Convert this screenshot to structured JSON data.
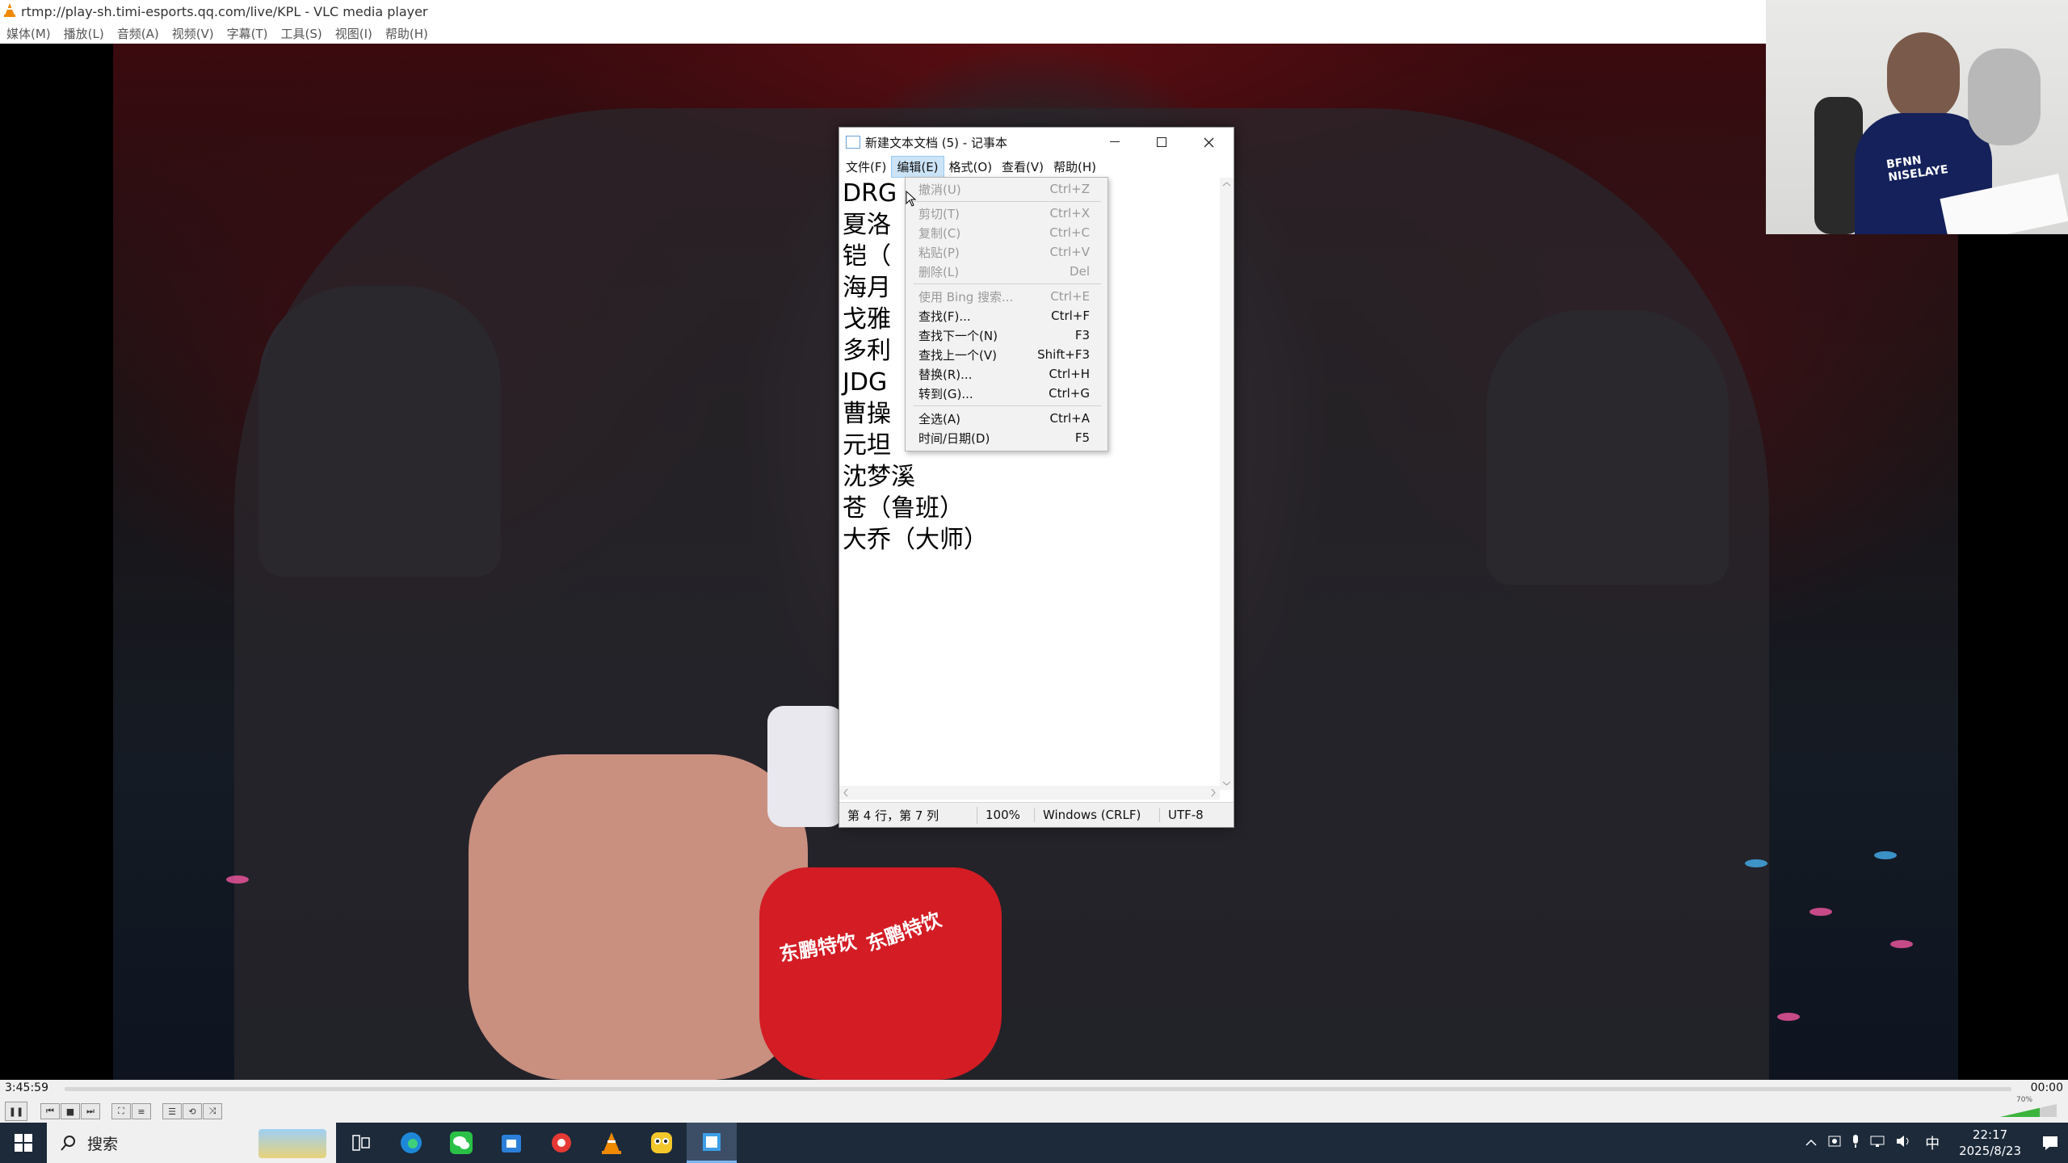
{
  "vlc": {
    "title": "rtmp://play-sh.timi-esports.qq.com/live/KPL - VLC media player",
    "menu": [
      "媒体(M)",
      "播放(L)",
      "音频(A)",
      "视频(V)",
      "字幕(T)",
      "工具(S)",
      "视图(I)",
      "帮助(H)"
    ],
    "time_elapsed": "3:45:59",
    "time_total": "00:00",
    "volume_label": "70%",
    "volume_level": 0.7,
    "video_bottle_text": [
      "东鹏特饮",
      "东鹏特饮",
      "东鹏特饮"
    ]
  },
  "webcam": {
    "shirt_text": "BFNN NISELAYE"
  },
  "notepad": {
    "title": "新建文本文档 (5) - 记事本",
    "menu": [
      "文件(F)",
      "编辑(E)",
      "格式(O)",
      "查看(V)",
      "帮助(H)"
    ],
    "active_menu": "编辑(E)",
    "lines": [
      "DRG",
      "夏洛",
      "铠（",
      "海月",
      "戈雅",
      "多利",
      "",
      "JDG",
      "曹操",
      "元坦",
      "沈梦溪",
      "苍（鲁班）",
      "大乔（大师）"
    ],
    "status": {
      "position": "第 4 行，第 7 列",
      "zoom": "100%",
      "line_ending": "Windows (CRLF)",
      "encoding": "UTF-8"
    }
  },
  "edit_menu": {
    "items": [
      {
        "label": "撤消(U)",
        "shortcut": "Ctrl+Z",
        "enabled": false
      },
      {
        "label": "剪切(T)",
        "shortcut": "Ctrl+X",
        "enabled": false
      },
      {
        "label": "复制(C)",
        "shortcut": "Ctrl+C",
        "enabled": false
      },
      {
        "label": "粘贴(P)",
        "shortcut": "Ctrl+V",
        "enabled": false
      },
      {
        "label": "删除(L)",
        "shortcut": "Del",
        "enabled": false
      },
      {
        "label": "使用 Bing 搜索...",
        "shortcut": "Ctrl+E",
        "enabled": false
      },
      {
        "label": "查找(F)...",
        "shortcut": "Ctrl+F",
        "enabled": true
      },
      {
        "label": "查找下一个(N)",
        "shortcut": "F3",
        "enabled": true
      },
      {
        "label": "查找上一个(V)",
        "shortcut": "Shift+F3",
        "enabled": true
      },
      {
        "label": "替换(R)...",
        "shortcut": "Ctrl+H",
        "enabled": true
      },
      {
        "label": "转到(G)...",
        "shortcut": "Ctrl+G",
        "enabled": true
      },
      {
        "label": "全选(A)",
        "shortcut": "Ctrl+A",
        "enabled": true
      },
      {
        "label": "时间/日期(D)",
        "shortcut": "F5",
        "enabled": true
      }
    ]
  },
  "taskbar": {
    "search_label": "搜索",
    "ime": "中",
    "time": "22:17",
    "date": "2025/8/23",
    "apps": [
      "task-view",
      "edge",
      "wechat",
      "store",
      "app-red",
      "vlc",
      "app-owl",
      "notepad"
    ],
    "active_app": "notepad"
  }
}
